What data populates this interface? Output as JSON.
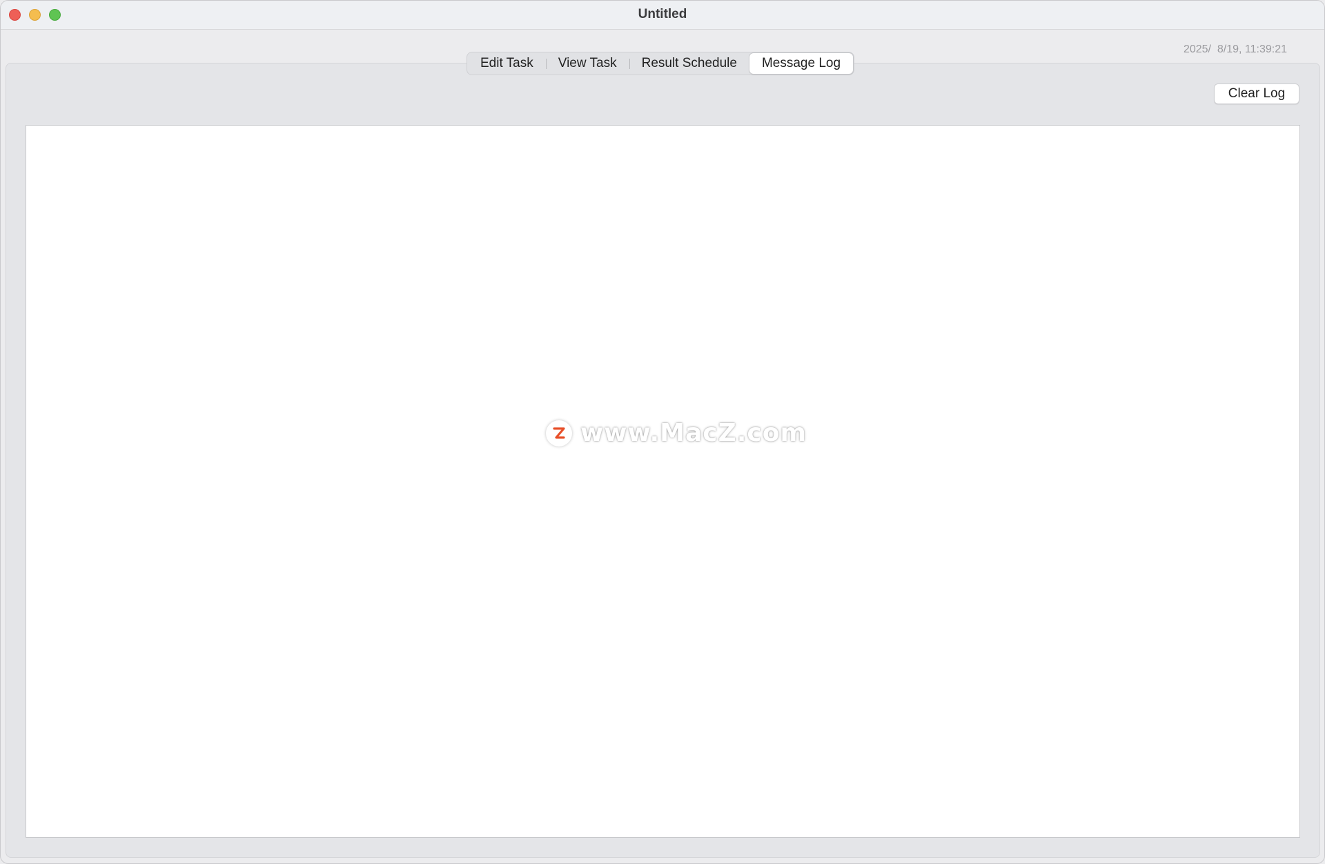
{
  "window": {
    "title": "Untitled"
  },
  "timestamp": "2025/  8/19, 11:39:21",
  "tabs": [
    {
      "label": "Edit Task",
      "selected": false
    },
    {
      "label": "View Task",
      "selected": false
    },
    {
      "label": "Result Schedule",
      "selected": false
    },
    {
      "label": "Message Log",
      "selected": true
    }
  ],
  "toolbar": {
    "clear_log_label": "Clear Log"
  },
  "log": {
    "content": ""
  },
  "watermark": {
    "text": "www.MacZ.com",
    "logo_color": "#e8502a"
  }
}
